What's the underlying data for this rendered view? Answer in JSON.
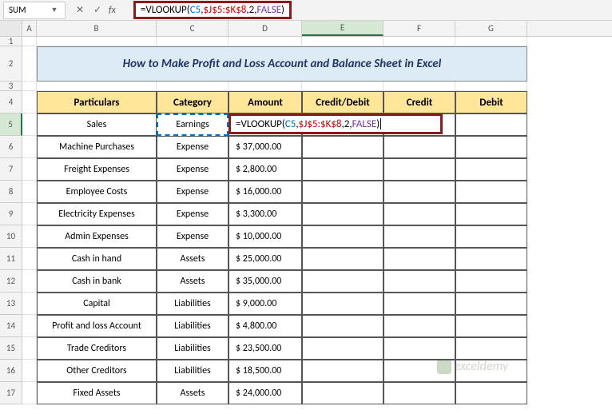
{
  "namebox": "SUM",
  "formula_parts": {
    "eq": "=",
    "func": "VLOOKUP(",
    "ref1": "C5",
    "c1": ",",
    "ref2": "$J$5:$K$8",
    "c2": ",",
    "num": "2",
    "c3": ",",
    "kw": "FALSE",
    "close": ")"
  },
  "title": "How to Make Profit and Loss Account and Balance Sheet in Excel",
  "headers": {
    "particulars": "Particulars",
    "category": "Category",
    "amount": "Amount",
    "creditdebit": "Credit/Debit",
    "credit": "Credit",
    "debit": "Debit"
  },
  "rows": [
    {
      "p": "Sales",
      "c": "Earnings",
      "a": ""
    },
    {
      "p": "Machine Purchases",
      "c": "Expense",
      "a": "$ 37,000.00"
    },
    {
      "p": "Freight Expenses",
      "c": "Expense",
      "a": "$  2,800.00"
    },
    {
      "p": "Employee Costs",
      "c": "Expense",
      "a": "$ 16,000.00"
    },
    {
      "p": "Electricity Expenses",
      "c": "Expense",
      "a": "$  3,300.00"
    },
    {
      "p": "Admin Expenses",
      "c": "Expense",
      "a": "$ 10,000.00"
    },
    {
      "p": "Cash in hand",
      "c": "Assets",
      "a": "$ 25,000.00"
    },
    {
      "p": "Cash in bank",
      "c": "Assets",
      "a": "$ 35,000.00"
    },
    {
      "p": "Capital",
      "c": "Liabilities",
      "a": "$  9,000.00"
    },
    {
      "p": "Profit and loss Account",
      "c": "Liabilities",
      "a": "$  4,800.00"
    },
    {
      "p": "Trade Creditors",
      "c": "Liabilities",
      "a": "$ 23,500.00"
    },
    {
      "p": "Other Creditors",
      "c": "Liabilities",
      "a": "$ 18,500.00"
    },
    {
      "p": "Fixed Assets",
      "c": "Assets",
      "a": "$ 24,000.00"
    }
  ],
  "watermark": "exceldemy",
  "cols": [
    "A",
    "B",
    "C",
    "D",
    "E",
    "F",
    "G"
  ],
  "rownums": [
    "1",
    "2",
    "3",
    "4",
    "5",
    "6",
    "7",
    "8",
    "9",
    "10",
    "11",
    "12",
    "13",
    "14",
    "15",
    "16",
    "17"
  ]
}
